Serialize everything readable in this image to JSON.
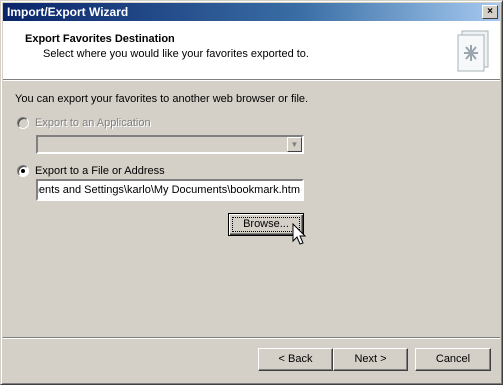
{
  "window": {
    "title": "Import/Export Wizard",
    "close_glyph": "×"
  },
  "header": {
    "title": "Export Favorites Destination",
    "subtitle": "Select where you would like your favorites exported to.",
    "graphic": "favorites-document-icon"
  },
  "body": {
    "intro": "You can export your favorites to another web browser or file.",
    "option_app": {
      "label": "Export to an Application",
      "selected": false,
      "enabled": false
    },
    "app_combo": {
      "value": "",
      "enabled": false
    },
    "option_file": {
      "label": "Export to a File or Address",
      "selected": true,
      "enabled": true
    },
    "file_path": "C:\\Documents and Settings\\karlo\\My Documents\\bookmark.htm",
    "browse_label": "Browse..."
  },
  "footer": {
    "back_label": "< Back",
    "next_label": "Next >",
    "cancel_label": "Cancel"
  }
}
